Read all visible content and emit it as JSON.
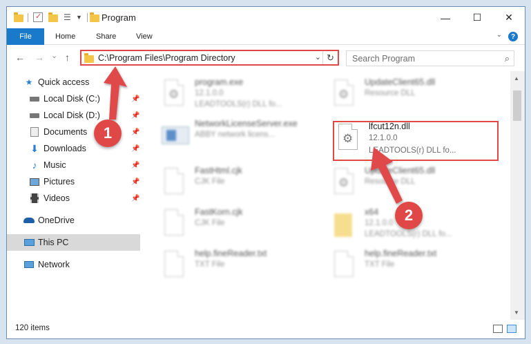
{
  "window": {
    "title": "Program",
    "minimize": "—",
    "maximize": "☐",
    "close": "✕"
  },
  "ribbon": {
    "tabs": [
      "File",
      "Home",
      "Share",
      "View"
    ],
    "help": "?"
  },
  "nav": {
    "back": "←",
    "forward": "→",
    "recent": "⌄",
    "up": "↑",
    "address": "C:\\Program Files\\Program Directory",
    "dropdown": "⌄",
    "refresh": "↻",
    "search_placeholder": "Search Program"
  },
  "sidebar": {
    "items": [
      {
        "label": "Quick access",
        "icon": "star-icon",
        "pinned": false
      },
      {
        "label": "Local Disk (C:)",
        "icon": "disk-icon",
        "pinned": true
      },
      {
        "label": "Local Disk (D:)",
        "icon": "disk-icon",
        "pinned": true
      },
      {
        "label": "Documents",
        "icon": "documents-icon",
        "pinned": true
      },
      {
        "label": "Downloads",
        "icon": "downloads-icon",
        "pinned": true
      },
      {
        "label": "Music",
        "icon": "music-icon",
        "pinned": true
      },
      {
        "label": "Pictures",
        "icon": "pictures-icon",
        "pinned": true
      },
      {
        "label": "Videos",
        "icon": "videos-icon",
        "pinned": true
      },
      {
        "label": "OneDrive",
        "icon": "onedrive-icon",
        "pinned": false
      },
      {
        "label": "This PC",
        "icon": "this-pc-icon",
        "pinned": false,
        "selected": true
      },
      {
        "label": "Network",
        "icon": "network-icon",
        "pinned": false
      }
    ]
  },
  "files": [
    {
      "name": "program.exe",
      "line1": "12.1.0.0",
      "line2": "LEADTOOLS(r) DLL fo...",
      "type": "exe",
      "blurred": true
    },
    {
      "name": "UpdateClient65.dll",
      "line1": "Resource DLL",
      "line2": "",
      "type": "dll",
      "blurred": true
    },
    {
      "name": "NetworkLicenseServer.exe",
      "line1": "ABBY network licens...",
      "line2": "",
      "type": "exe2",
      "blurred": true
    },
    {
      "name": "lfcut12n.dll",
      "line1": "12.1.0.0",
      "line2": "LEADTOOLS(r) DLL fo...",
      "type": "dll",
      "blurred": false,
      "highlighted": true
    },
    {
      "name": "FastHtml.cjk",
      "line1": "CJK File",
      "line2": "",
      "type": "doc",
      "blurred": true
    },
    {
      "name": "UpdateClient65.dll",
      "line1": "Resource DLL",
      "line2": "",
      "type": "dll",
      "blurred": true
    },
    {
      "name": "FastKorn.cjk",
      "line1": "CJK File",
      "line2": "",
      "type": "doc",
      "blurred": true
    },
    {
      "name": "x64",
      "line1": "12.1.0.0",
      "line2": "LEADTOOLS(r) DLL fo...",
      "type": "folder",
      "blurred": true
    },
    {
      "name": "help.fineReader.txt",
      "line1": "TXT File",
      "line2": "",
      "type": "doc",
      "blurred": true
    },
    {
      "name": "help.fineReader.txt",
      "line1": "TXT File",
      "line2": "",
      "type": "doc",
      "blurred": true
    }
  ],
  "status": {
    "item_count": "120 items"
  },
  "annotations": {
    "step1": "1",
    "step2": "2",
    "color": "#e04848"
  }
}
